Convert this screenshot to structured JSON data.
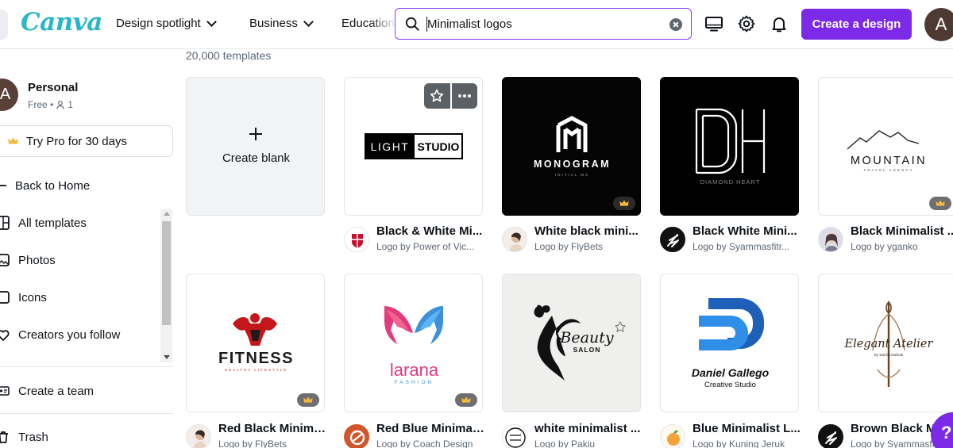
{
  "app": {
    "logo": "Canva"
  },
  "nav": {
    "items": [
      {
        "label": "Design spotlight"
      },
      {
        "label": "Business"
      },
      {
        "label": "Education"
      }
    ]
  },
  "search": {
    "value": "Minimalist logos",
    "placeholder": ""
  },
  "toolbar": {
    "create_label": "Create a design",
    "avatar_initial": "A"
  },
  "account": {
    "initial": "A",
    "name": "Personal",
    "plan": "Free •",
    "members": "1"
  },
  "sidebar": {
    "pro_label": "Try Pro for 30 days",
    "items": [
      {
        "label": "Back to Home"
      },
      {
        "label": "All templates"
      },
      {
        "label": "Photos"
      },
      {
        "label": "Icons"
      },
      {
        "label": "Creators you follow"
      },
      {
        "label": "Create a team"
      },
      {
        "label": "Trash"
      }
    ]
  },
  "results": {
    "count": "20,000 templates",
    "blank_label": "Create blank",
    "templates": [
      {
        "title": "Black & White Mi...",
        "author": "Logo by Power of Vic...",
        "thumb": {
          "line1": "LIGHT",
          "line2": "STUDIO"
        },
        "pro": false
      },
      {
        "title": "White black mini...",
        "author": "Logo by FlyBets",
        "thumb": {
          "line1": "MONOGRAM",
          "line2": "INITIAL MS"
        },
        "pro": true
      },
      {
        "title": "Black White Mini...",
        "author": "Logo by Syammasfitr...",
        "thumb": {
          "line1": "DIAMOND HEART"
        },
        "pro": false
      },
      {
        "title": "Black Minimalist ...",
        "author": "Logo by yganko",
        "thumb": {
          "line1": "MOUNTAIN",
          "line2": "TRAVEL AGENCY"
        },
        "pro": true
      },
      {
        "title": "Red Black Minima...",
        "author": "Logo by FlyBets",
        "thumb": {
          "line1": "FITNESS",
          "line2": "HEALTHY LIFESTYLE"
        },
        "pro": true
      },
      {
        "title": "Red Blue Minimal...",
        "author": "Logo by Coach Design",
        "thumb": {
          "line1": "larana",
          "line2": "FASHION"
        },
        "pro": true
      },
      {
        "title": "white minimalist ...",
        "author": "Logo by Pakiu",
        "thumb": {
          "line1": "Beauty",
          "line2": "SALON"
        },
        "pro": false
      },
      {
        "title": "Blue Minimalist L...",
        "author": "Logo by Kuning Jeruk",
        "thumb": {
          "line1": "Daniel Gallego",
          "line2": "Creative Studio"
        },
        "pro": false
      },
      {
        "title": "Brown Black Mi...",
        "author": "Logo by Syammasfitr...",
        "thumb": {
          "line1": "Elegant Atelier",
          "line2": "by Sacha Dubois"
        },
        "pro": false
      }
    ]
  },
  "help": {
    "label": "?"
  },
  "colors": {
    "accent": "#7d2ae8",
    "logo": "#28b6c8",
    "search_border": "#8b3dff"
  }
}
